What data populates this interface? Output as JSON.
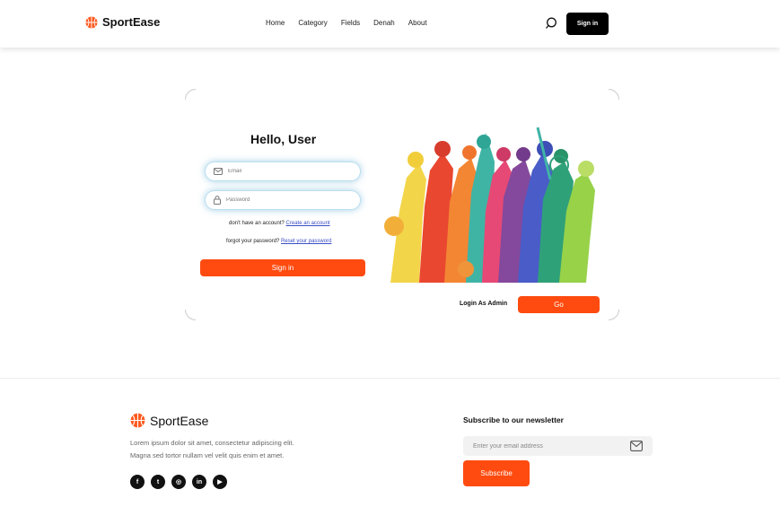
{
  "brand": {
    "name": "SportEase"
  },
  "nav": {
    "items": [
      "Home",
      "Category",
      "Fields",
      "Denah",
      "About"
    ],
    "signin_label": "Sign in"
  },
  "login": {
    "heading": "Hello, User",
    "email_placeholder": "Email",
    "password_placeholder": "Password",
    "no_account_text": "don't have an account?",
    "create_account_link": "Create an account",
    "forgot_text": "forgot your password?",
    "reset_link": "Reset your password",
    "signin_label": "Sign in"
  },
  "admin": {
    "label": "Login As Admin",
    "go_label": "Go"
  },
  "footer": {
    "brand": "SportEase",
    "description_line1": "Lorem ipsum dolor sit amet, consectetur adipiscing elit.",
    "description_line2": "Magna sed tortor nullam vel velit quis enim et amet.",
    "socials": [
      {
        "icon": "facebook-icon",
        "glyph": "f"
      },
      {
        "icon": "twitter-icon",
        "glyph": "t"
      },
      {
        "icon": "instagram-icon",
        "glyph": "◎"
      },
      {
        "icon": "linkedin-icon",
        "glyph": "in"
      },
      {
        "icon": "youtube-icon",
        "glyph": "▶"
      }
    ],
    "newsletter_title": "Subscribe to our newsletter",
    "newsletter_placeholder": "Enter your email address",
    "subscribe_label": "Subscribe"
  },
  "colors": {
    "accent": "#ff4b0f",
    "dark": "#000000"
  }
}
